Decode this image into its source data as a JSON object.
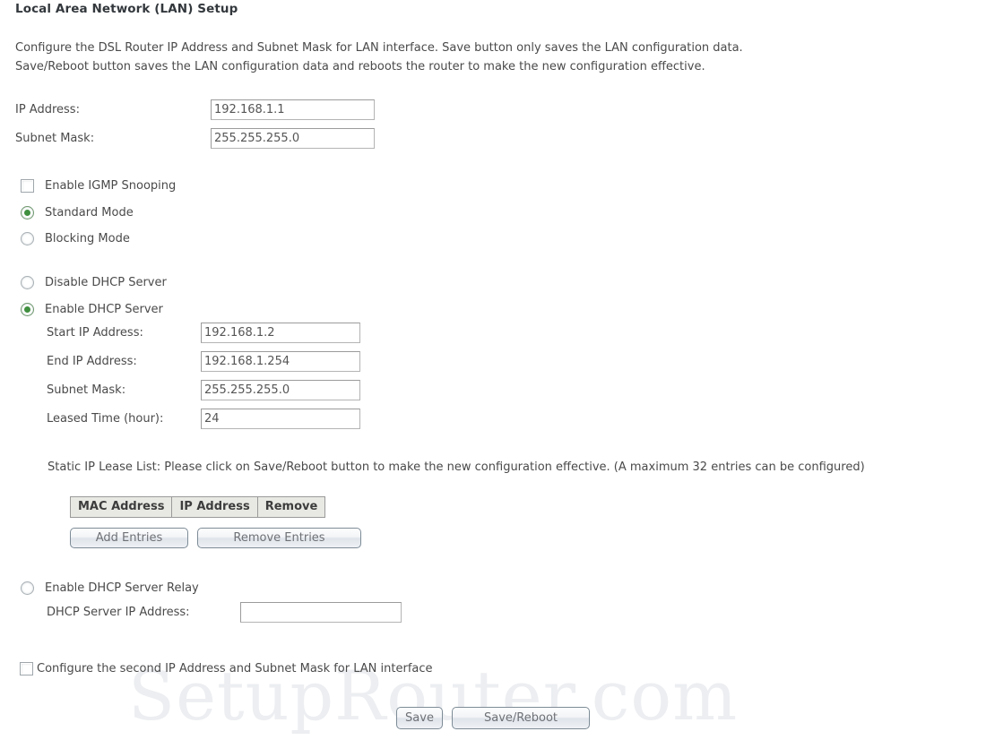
{
  "page": {
    "title": "Local Area Network (LAN) Setup",
    "intro_line1": "Configure the DSL Router IP Address and Subnet Mask for LAN interface.  Save button only saves the LAN configuration data.",
    "intro_line2": "Save/Reboot button saves the LAN configuration data and reboots the router to make the new configuration effective.",
    "watermark": "SetupRouter.com"
  },
  "lan": {
    "ip_address_label": "IP Address:",
    "ip_address_value": "192.168.1.1",
    "subnet_mask_label": "Subnet Mask:",
    "subnet_mask_value": "255.255.255.0"
  },
  "igmp": {
    "enable_snooping_label": "Enable IGMP Snooping",
    "enable_snooping_checked": false,
    "standard_mode_label": "Standard Mode",
    "standard_mode_selected": true,
    "blocking_mode_label": "Blocking Mode",
    "blocking_mode_selected": false
  },
  "dhcp": {
    "disable_label": "Disable DHCP Server",
    "disable_selected": false,
    "enable_label": "Enable DHCP Server",
    "enable_selected": true,
    "start_ip_label": "Start IP Address:",
    "start_ip_value": "192.168.1.2",
    "end_ip_label": "End IP Address:",
    "end_ip_value": "192.168.1.254",
    "subnet_mask_label": "Subnet Mask:",
    "subnet_mask_value": "255.255.255.0",
    "leased_time_label": "Leased Time (hour):",
    "leased_time_value": "24"
  },
  "lease_list": {
    "note": "Static IP Lease List: Please click on Save/Reboot button to make the new configuration effective. (A maximum 32 entries can be configured)",
    "columns": [
      "MAC Address",
      "IP Address",
      "Remove"
    ],
    "rows": [],
    "add_button": "Add Entries",
    "remove_button": "Remove Entries"
  },
  "relay": {
    "enable_label": "Enable DHCP Server Relay",
    "enable_selected": false,
    "server_ip_label": "DHCP Server IP Address:",
    "server_ip_value": "",
    "server_ip_placeholder": ""
  },
  "second_ip": {
    "label": "Configure the second IP Address and Subnet Mask for LAN interface",
    "checked": false
  },
  "actions": {
    "save_label": "Save",
    "save_reboot_label": "Save/Reboot"
  }
}
